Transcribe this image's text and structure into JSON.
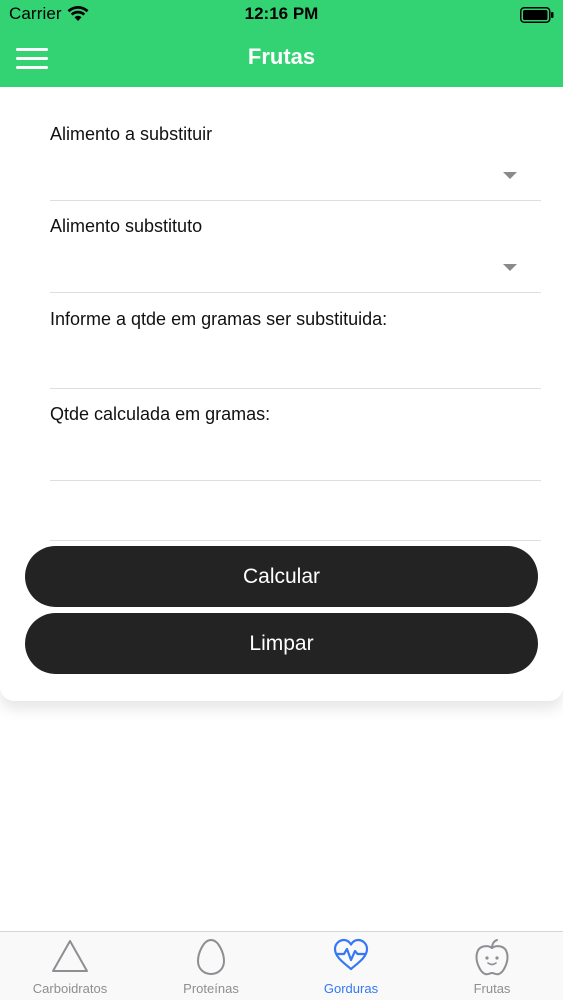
{
  "status_bar": {
    "carrier": "Carrier",
    "time": "12:16 PM"
  },
  "nav": {
    "title": "Frutas",
    "menu_icon": "hamburger-menu-icon"
  },
  "form": {
    "food_to_replace_label": "Alimento a substituir",
    "food_to_replace_value": "",
    "substitute_food_label": "Alimento substituto",
    "substitute_food_value": "",
    "grams_input_label": "Informe a qtde em gramas ser substituida:",
    "grams_input_value": "",
    "calculated_label": "Qtde calculada em gramas:",
    "calculated_value": ""
  },
  "buttons": {
    "calculate": "Calcular",
    "clear": "Limpar"
  },
  "tab_bar": {
    "active_index": 2,
    "items": [
      {
        "label": "Carboidratos",
        "icon": "triangle-icon"
      },
      {
        "label": "Proteínas",
        "icon": "egg-icon"
      },
      {
        "label": "Gorduras",
        "icon": "heart-pulse-icon"
      },
      {
        "label": "Frutas",
        "icon": "apple-icon"
      }
    ]
  },
  "colors": {
    "header": "#33d374",
    "button": "#232323",
    "active_tab": "#3478f6",
    "inactive_tab": "#8e8e93"
  }
}
